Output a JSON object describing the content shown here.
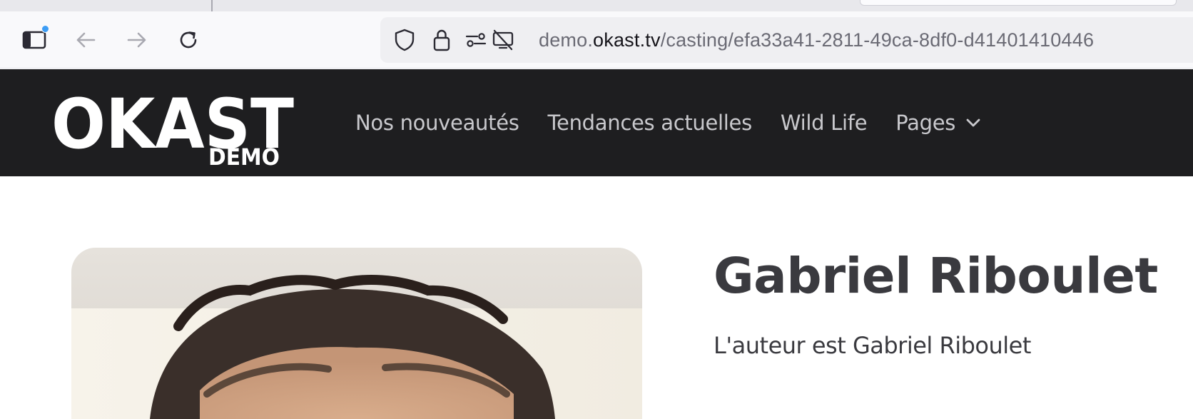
{
  "browser": {
    "toolbar": {
      "sidebar_icon": "sidebar-icon",
      "back_icon": "arrow-left-icon",
      "forward_icon": "arrow-right-icon",
      "reload_icon": "reload-icon"
    },
    "urlbar": {
      "url_prefix": "demo.",
      "url_host": "okast.tv",
      "url_path": "/casting/efa33a41-2811-49ca-8df0-d41401410446",
      "icons": [
        "shield-icon",
        "lock-icon",
        "permissions-icon",
        "screen-share-blocked-icon"
      ]
    }
  },
  "site": {
    "logo": {
      "main": "OKAST",
      "sub": "DEMO"
    },
    "nav": {
      "items": [
        {
          "label": "Nos nouveautés"
        },
        {
          "label": "Tendances actuelles"
        },
        {
          "label": "Wild Life"
        },
        {
          "label": "Pages"
        }
      ],
      "pages_icon": "chevron-down-icon"
    }
  },
  "profile": {
    "name": "Gabriel Riboulet",
    "bio": "L'auteur est Gabriel Riboulet"
  },
  "colors": {
    "nav_background": "#1e1e20",
    "nav_text": "#c9c9cd",
    "heading_text": "#3a3a3f",
    "accent_dot": "#3d9df5"
  }
}
